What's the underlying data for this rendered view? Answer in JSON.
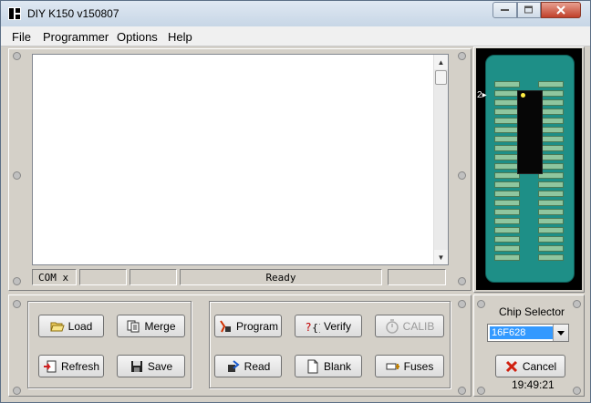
{
  "window": {
    "title": "DIY K150 v150807"
  },
  "menu": [
    "File",
    "Programmer",
    "Options",
    "Help"
  ],
  "status_bar": {
    "port": "COM x",
    "message": "Ready"
  },
  "buttons": {
    "load": "Load",
    "merge": "Merge",
    "refresh": "Refresh",
    "save": "Save",
    "program": "Program",
    "verify": "Verify",
    "calib": "CALIB",
    "read": "Read",
    "blank": "Blank",
    "fuses": "Fuses",
    "cancel": "Cancel"
  },
  "chip_view": {
    "pin1_label": "2"
  },
  "chip_selector": {
    "label": "Chip Selector",
    "value": "16F628"
  },
  "clock": "19:49:21",
  "colors": {
    "socket": "#1e8f87",
    "pin": "#8fc69f",
    "selection": "#3399ff"
  }
}
